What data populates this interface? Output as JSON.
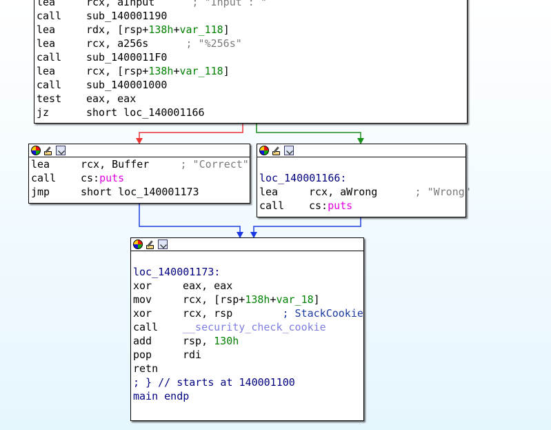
{
  "top_block": {
    "lines": [
      {
        "m": "lea",
        "a": "rcx, aInput",
        "c": "; \"Input : \""
      },
      {
        "m": "call",
        "a": "sub_140001190"
      },
      {
        "m": "lea",
        "a1": "rdx, [rsp+",
        "g1": "138h",
        "a2": "+",
        "g2": "var_118",
        "a3": "]"
      },
      {
        "m": "lea",
        "a": "rcx, a256s",
        "c": "; \"%256s\""
      },
      {
        "m": "call",
        "a": "sub_1400011F0"
      },
      {
        "m": "lea",
        "a1": "rcx, [rsp+",
        "g1": "138h",
        "a2": "+",
        "g2": "var_118",
        "a3": "]"
      },
      {
        "m": "call",
        "a": "sub_140001000"
      },
      {
        "m": "test",
        "a": "eax, eax"
      },
      {
        "m": "jz",
        "a": "short loc_140001166"
      }
    ]
  },
  "left_block": {
    "l1_m": "lea",
    "l1_a": "rcx, Buffer",
    "l1_c": "; \"Correct\"",
    "l2_m": "call",
    "l2_a": "cs:",
    "l2_f": "puts",
    "l3_m": "jmp",
    "l3_a": "short loc_140001173"
  },
  "right_block": {
    "label": "loc_140001166:",
    "l1_m": "lea",
    "l1_a": "rcx, aWrong",
    "l1_c": "; \"Wrong\"",
    "l2_m": "call",
    "l2_a": "cs:",
    "l2_f": "puts"
  },
  "bottom_block": {
    "label": "loc_140001173:",
    "l1_m": "xor",
    "l1_a": "eax, eax",
    "l2_m": "mov",
    "l2_a1": "rcx, [rsp+",
    "l2_g1": "138h",
    "l2_a2": "+",
    "l2_g2": "var_18",
    "l2_a3": "]",
    "l3_m": "xor",
    "l3_a": "rcx, rsp",
    "l3_c": "; StackCookie",
    "l4_m": "call",
    "l4_f": "__security_check_cookie",
    "l5_m": "add",
    "l5_a": "rsp, ",
    "l5_g": "130h",
    "l6_m": "pop",
    "l6_a": "rdi",
    "l7_m": "retn",
    "l8": "; } // starts at 140001100",
    "l9": "main endp"
  },
  "icons": [
    "color-icon",
    "rename-icon",
    "graph-overview-icon"
  ],
  "colors": {
    "true_edge": "#e33",
    "false_edge": "#1a8f1a",
    "jump_edge": "#1a3ae0",
    "operand_green": "#008000",
    "import_func": "#e000e0",
    "comment_gray": "#7a7a7a"
  }
}
